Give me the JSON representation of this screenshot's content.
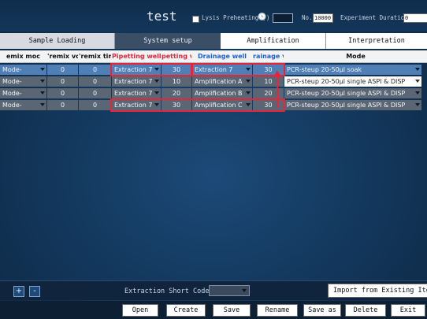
{
  "window": {
    "title": "test",
    "lysis_label": "Lysis Preheating (",
    "lysis_unit_icon": "clock-icon",
    "lysis_close": ")",
    "lysis_value": "",
    "no_label": "No.",
    "no_value": "10000",
    "duration_label": "Experiment Duration",
    "duration_value": "0"
  },
  "tabs": [
    {
      "label": "Sample Loading"
    },
    {
      "label": "System setup"
    },
    {
      "label": "Amplification"
    },
    {
      "label": "Interpretation"
    }
  ],
  "grid": {
    "columns": [
      "emix moc",
      "'remix vc",
      "'remix tim",
      "Pipetting well",
      "petting v",
      "Drainage well",
      "rainage v",
      "Mode"
    ],
    "rows": [
      [
        "Mode-",
        "0",
        "0",
        "Extraction 7",
        "30",
        "Extraction 7",
        "30",
        "PCR-steup 20-50μl soak"
      ],
      [
        "Mode-",
        "0",
        "0",
        "Extraction 7",
        "10",
        "Amplification A",
        "10",
        "PCR-steup 20-50μl single ASPI & DISP"
      ],
      [
        "Mode-",
        "0",
        "0",
        "Extraction 7",
        "20",
        "Amplification B",
        "20",
        "PCR-steup 20-50μl single ASPI & DISP"
      ],
      [
        "Mode-",
        "0",
        "0",
        "Extraction 7",
        "30",
        "Amplification C",
        "30",
        "PCR-steup 20-50μl single ASPI & DISP"
      ]
    ]
  },
  "bottom": {
    "add_label": "+",
    "remove_label": "-",
    "short_code_label": "Extraction Short Code:",
    "short_code_value": "",
    "import_label": "Import from Existing Item"
  },
  "actions": [
    "Open",
    "Create",
    "Save",
    "Rename",
    "Save as",
    "Delete",
    "Exit"
  ],
  "colors": {
    "accent_red": "#e8243a",
    "accent_blue": "#1f5fd6",
    "selected_row": "#4f7fb5",
    "normal_row": "#5b6674"
  }
}
